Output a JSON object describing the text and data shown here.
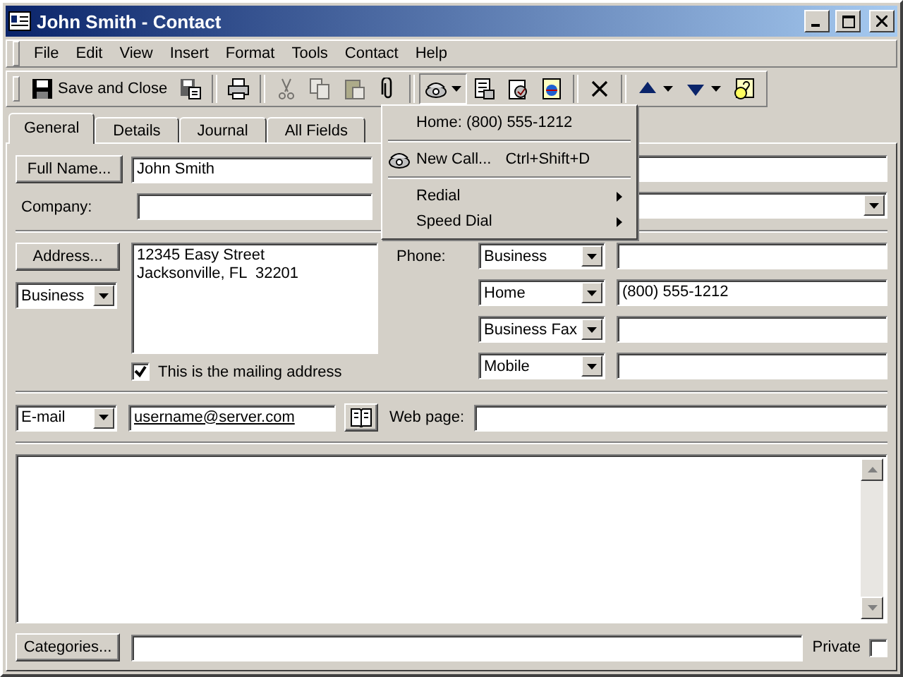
{
  "window": {
    "title": "John Smith - Contact"
  },
  "menu_bar": [
    "File",
    "Edit",
    "View",
    "Insert",
    "Format",
    "Tools",
    "Contact",
    "Help"
  ],
  "toolbar": {
    "save_close": "Save and Close",
    "buttons": [
      {
        "kind": "save_as",
        "disabled": false
      },
      {
        "kind": "print",
        "disabled": false
      },
      {
        "kind": "cut",
        "disabled": true
      },
      {
        "kind": "copy",
        "disabled": true
      },
      {
        "kind": "paste",
        "disabled": true
      },
      {
        "kind": "attach",
        "disabled": false
      },
      {
        "kind": "dial",
        "disabled": false
      },
      {
        "kind": "meeting",
        "disabled": false
      },
      {
        "kind": "task",
        "disabled": false
      },
      {
        "kind": "web",
        "disabled": false
      },
      {
        "kind": "delete",
        "disabled": false
      },
      {
        "kind": "previous",
        "disabled": false
      },
      {
        "kind": "next",
        "disabled": false
      },
      {
        "kind": "help",
        "disabled": false
      }
    ]
  },
  "dial_menu": [
    {
      "kind": "item",
      "label": "Home: (800) 555-1212"
    },
    {
      "kind": "separator"
    },
    {
      "kind": "phone_item",
      "label": "New Call...",
      "shortcut": "Ctrl+Shift+D"
    },
    {
      "kind": "separator"
    },
    {
      "kind": "submenu",
      "label": "Redial"
    },
    {
      "kind": "submenu",
      "label": "Speed Dial"
    }
  ],
  "tabs": [
    {
      "label": "General",
      "selected": true
    },
    {
      "label": "Details",
      "selected": false
    },
    {
      "label": "Journal",
      "selected": false
    },
    {
      "label": "All Fields",
      "selected": false
    }
  ],
  "form": {
    "full_name_button": "Full Name...",
    "full_name": "John Smith",
    "company_label": "Company:",
    "address_button": "Address...",
    "address_type": "Business",
    "address_lines": [
      "12345 Easy Street",
      "Jacksonville, FL  32201"
    ],
    "mailing_label": "This is the mailing address",
    "mailing_checked": true,
    "phone_label": "Phone:",
    "phones": [
      {
        "type": "Business"
      },
      {
        "type": "Home",
        "number": "(800) 555-1212"
      },
      {
        "type": "Business Fax"
      },
      {
        "type": "Mobile"
      }
    ],
    "email_type": "E-mail",
    "email": "username@server.com",
    "web_label": "Web page:",
    "categories_button": "Categories...",
    "private_label": "Private",
    "private_checked": false
  }
}
